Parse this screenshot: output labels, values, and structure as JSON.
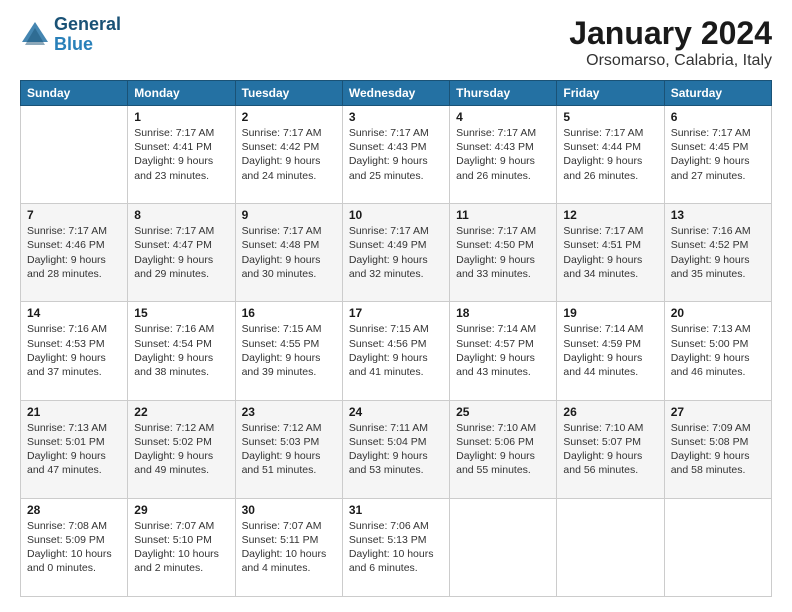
{
  "header": {
    "logo_line1": "General",
    "logo_line2": "Blue",
    "title": "January 2024",
    "subtitle": "Orsomarso, Calabria, Italy"
  },
  "calendar": {
    "day_headers": [
      "Sunday",
      "Monday",
      "Tuesday",
      "Wednesday",
      "Thursday",
      "Friday",
      "Saturday"
    ],
    "weeks": [
      [
        {
          "day": "",
          "info": ""
        },
        {
          "day": "1",
          "info": "Sunrise: 7:17 AM\nSunset: 4:41 PM\nDaylight: 9 hours\nand 23 minutes."
        },
        {
          "day": "2",
          "info": "Sunrise: 7:17 AM\nSunset: 4:42 PM\nDaylight: 9 hours\nand 24 minutes."
        },
        {
          "day": "3",
          "info": "Sunrise: 7:17 AM\nSunset: 4:43 PM\nDaylight: 9 hours\nand 25 minutes."
        },
        {
          "day": "4",
          "info": "Sunrise: 7:17 AM\nSunset: 4:43 PM\nDaylight: 9 hours\nand 26 minutes."
        },
        {
          "day": "5",
          "info": "Sunrise: 7:17 AM\nSunset: 4:44 PM\nDaylight: 9 hours\nand 26 minutes."
        },
        {
          "day": "6",
          "info": "Sunrise: 7:17 AM\nSunset: 4:45 PM\nDaylight: 9 hours\nand 27 minutes."
        }
      ],
      [
        {
          "day": "7",
          "info": "Sunrise: 7:17 AM\nSunset: 4:46 PM\nDaylight: 9 hours\nand 28 minutes."
        },
        {
          "day": "8",
          "info": "Sunrise: 7:17 AM\nSunset: 4:47 PM\nDaylight: 9 hours\nand 29 minutes."
        },
        {
          "day": "9",
          "info": "Sunrise: 7:17 AM\nSunset: 4:48 PM\nDaylight: 9 hours\nand 30 minutes."
        },
        {
          "day": "10",
          "info": "Sunrise: 7:17 AM\nSunset: 4:49 PM\nDaylight: 9 hours\nand 32 minutes."
        },
        {
          "day": "11",
          "info": "Sunrise: 7:17 AM\nSunset: 4:50 PM\nDaylight: 9 hours\nand 33 minutes."
        },
        {
          "day": "12",
          "info": "Sunrise: 7:17 AM\nSunset: 4:51 PM\nDaylight: 9 hours\nand 34 minutes."
        },
        {
          "day": "13",
          "info": "Sunrise: 7:16 AM\nSunset: 4:52 PM\nDaylight: 9 hours\nand 35 minutes."
        }
      ],
      [
        {
          "day": "14",
          "info": "Sunrise: 7:16 AM\nSunset: 4:53 PM\nDaylight: 9 hours\nand 37 minutes."
        },
        {
          "day": "15",
          "info": "Sunrise: 7:16 AM\nSunset: 4:54 PM\nDaylight: 9 hours\nand 38 minutes."
        },
        {
          "day": "16",
          "info": "Sunrise: 7:15 AM\nSunset: 4:55 PM\nDaylight: 9 hours\nand 39 minutes."
        },
        {
          "day": "17",
          "info": "Sunrise: 7:15 AM\nSunset: 4:56 PM\nDaylight: 9 hours\nand 41 minutes."
        },
        {
          "day": "18",
          "info": "Sunrise: 7:14 AM\nSunset: 4:57 PM\nDaylight: 9 hours\nand 43 minutes."
        },
        {
          "day": "19",
          "info": "Sunrise: 7:14 AM\nSunset: 4:59 PM\nDaylight: 9 hours\nand 44 minutes."
        },
        {
          "day": "20",
          "info": "Sunrise: 7:13 AM\nSunset: 5:00 PM\nDaylight: 9 hours\nand 46 minutes."
        }
      ],
      [
        {
          "day": "21",
          "info": "Sunrise: 7:13 AM\nSunset: 5:01 PM\nDaylight: 9 hours\nand 47 minutes."
        },
        {
          "day": "22",
          "info": "Sunrise: 7:12 AM\nSunset: 5:02 PM\nDaylight: 9 hours\nand 49 minutes."
        },
        {
          "day": "23",
          "info": "Sunrise: 7:12 AM\nSunset: 5:03 PM\nDaylight: 9 hours\nand 51 minutes."
        },
        {
          "day": "24",
          "info": "Sunrise: 7:11 AM\nSunset: 5:04 PM\nDaylight: 9 hours\nand 53 minutes."
        },
        {
          "day": "25",
          "info": "Sunrise: 7:10 AM\nSunset: 5:06 PM\nDaylight: 9 hours\nand 55 minutes."
        },
        {
          "day": "26",
          "info": "Sunrise: 7:10 AM\nSunset: 5:07 PM\nDaylight: 9 hours\nand 56 minutes."
        },
        {
          "day": "27",
          "info": "Sunrise: 7:09 AM\nSunset: 5:08 PM\nDaylight: 9 hours\nand 58 minutes."
        }
      ],
      [
        {
          "day": "28",
          "info": "Sunrise: 7:08 AM\nSunset: 5:09 PM\nDaylight: 10 hours\nand 0 minutes."
        },
        {
          "day": "29",
          "info": "Sunrise: 7:07 AM\nSunset: 5:10 PM\nDaylight: 10 hours\nand 2 minutes."
        },
        {
          "day": "30",
          "info": "Sunrise: 7:07 AM\nSunset: 5:11 PM\nDaylight: 10 hours\nand 4 minutes."
        },
        {
          "day": "31",
          "info": "Sunrise: 7:06 AM\nSunset: 5:13 PM\nDaylight: 10 hours\nand 6 minutes."
        },
        {
          "day": "",
          "info": ""
        },
        {
          "day": "",
          "info": ""
        },
        {
          "day": "",
          "info": ""
        }
      ]
    ]
  }
}
